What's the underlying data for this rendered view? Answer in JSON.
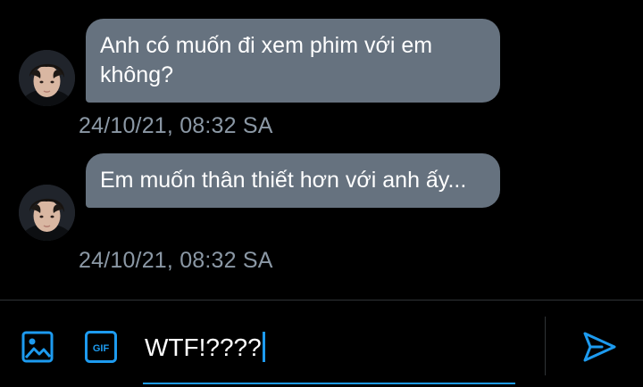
{
  "messages": [
    {
      "text": "Anh có muốn đi xem phim với em không?",
      "timestamp": "24/10/21, 08:32 SA"
    },
    {
      "text": "Em muốn thân thiết hơn với anh ấy...",
      "timestamp": "24/10/21, 08:32 SA"
    }
  ],
  "composer": {
    "input_value": "WTF!????",
    "icons": {
      "media": "image-icon",
      "gif": "gif-icon",
      "send": "send-icon"
    },
    "gif_label": "GIF"
  },
  "colors": {
    "background": "#000000",
    "bubble": "#66727f",
    "timestamp": "#8b98a5",
    "accent": "#1d9bf0",
    "divider": "#2f3336"
  }
}
